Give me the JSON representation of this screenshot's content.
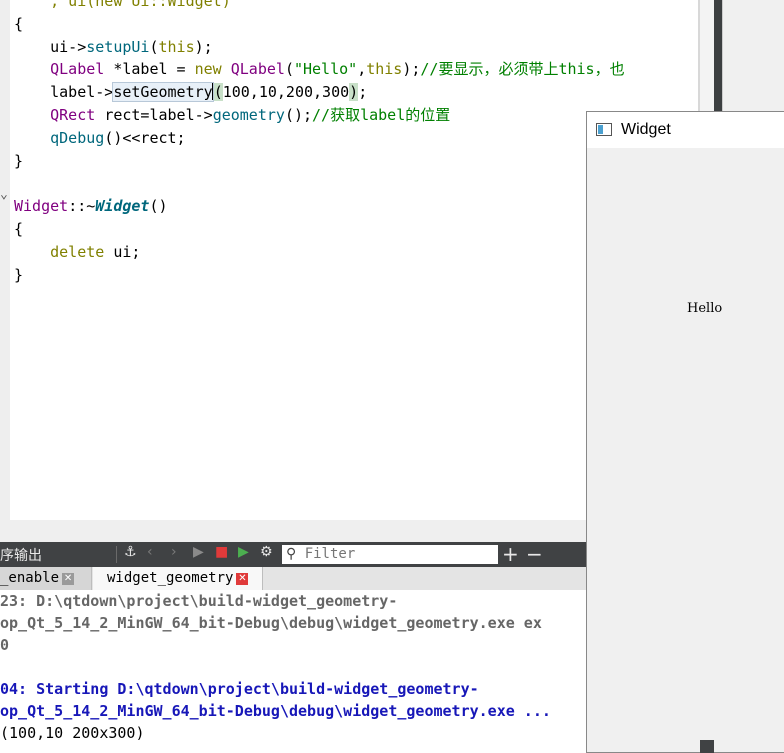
{
  "editor": {
    "lines": [
      {
        "parts": [
          [
            "kw",
            "    , ui(new Ui::Widget)"
          ]
        ]
      },
      {
        "parts": [
          [
            "n",
            "{"
          ]
        ]
      },
      {
        "parts": [
          [
            "n",
            "    ui->"
          ],
          [
            "fn",
            "setupUi"
          ],
          [
            "n",
            "("
          ],
          [
            "kw",
            "this"
          ],
          [
            "n",
            ");"
          ]
        ]
      },
      {
        "parts": [
          [
            "ty",
            "    QLabel "
          ],
          [
            "n",
            "*label = "
          ],
          [
            "kw",
            "new "
          ],
          [
            "ty",
            "QLabel"
          ],
          [
            "n",
            "("
          ],
          [
            "st",
            "\"Hello\""
          ],
          [
            "n",
            ","
          ],
          [
            "kw",
            "this"
          ],
          [
            "n",
            ");"
          ],
          [
            "cm",
            "//要显示，必须带上this，也"
          ]
        ]
      },
      {
        "parts": [
          [
            "n",
            "    label->"
          ],
          [
            "hl",
            "setGeometry"
          ],
          [
            "cursor",
            ""
          ],
          [
            "hlp",
            "("
          ],
          [
            "n",
            "100,10,200,300"
          ],
          [
            "hlp",
            ")"
          ],
          [
            "n",
            ";"
          ]
        ]
      },
      {
        "parts": [
          [
            "ty",
            "    QRect "
          ],
          [
            "n",
            "rect=label->"
          ],
          [
            "fn",
            "geometry"
          ],
          [
            "n",
            "();"
          ],
          [
            "cm",
            "//获取label的位置"
          ]
        ]
      },
      {
        "parts": [
          [
            "fn",
            "    qDebug"
          ],
          [
            "n",
            "()<<rect;"
          ]
        ]
      },
      {
        "parts": [
          [
            "n",
            "}"
          ]
        ]
      },
      {
        "parts": [
          [
            "n",
            ""
          ]
        ]
      },
      {
        "parts": [
          [
            "ty",
            "Widget"
          ],
          [
            "n",
            "::~"
          ],
          [
            "it",
            "Widget"
          ],
          [
            "n",
            "()"
          ]
        ]
      },
      {
        "parts": [
          [
            "n",
            "{"
          ]
        ]
      },
      {
        "parts": [
          [
            "kw",
            "    delete "
          ],
          [
            "n",
            "ui;"
          ]
        ]
      },
      {
        "parts": [
          [
            "n",
            "}"
          ]
        ]
      }
    ]
  },
  "output_toolbar": {
    "title": "序输出",
    "filter_placeholder": "Filter",
    "plus": "+",
    "minus": "−"
  },
  "tabs": [
    {
      "label": "_enable",
      "active": false
    },
    {
      "label": "widget_geometry",
      "active": true
    }
  ],
  "output": {
    "lines": [
      {
        "cls": "gray",
        "text": "23: D:\\qtdown\\project\\build-widget_geometry-"
      },
      {
        "cls": "gray",
        "text": "op_Qt_5_14_2_MinGW_64_bit-Debug\\debug\\widget_geometry.exe ex"
      },
      {
        "cls": "gray",
        "text": "0"
      },
      {
        "cls": "gray",
        "text": ""
      },
      {
        "cls": "blue",
        "text": "04: Starting D:\\qtdown\\project\\build-widget_geometry-"
      },
      {
        "cls": "blue",
        "text": "op_Qt_5_14_2_MinGW_64_bit-Debug\\debug\\widget_geometry.exe ..."
      },
      {
        "cls": "norm",
        "text": "(100,10 200x300)"
      }
    ]
  },
  "widget_window": {
    "title": "Widget",
    "label": "Hello"
  }
}
